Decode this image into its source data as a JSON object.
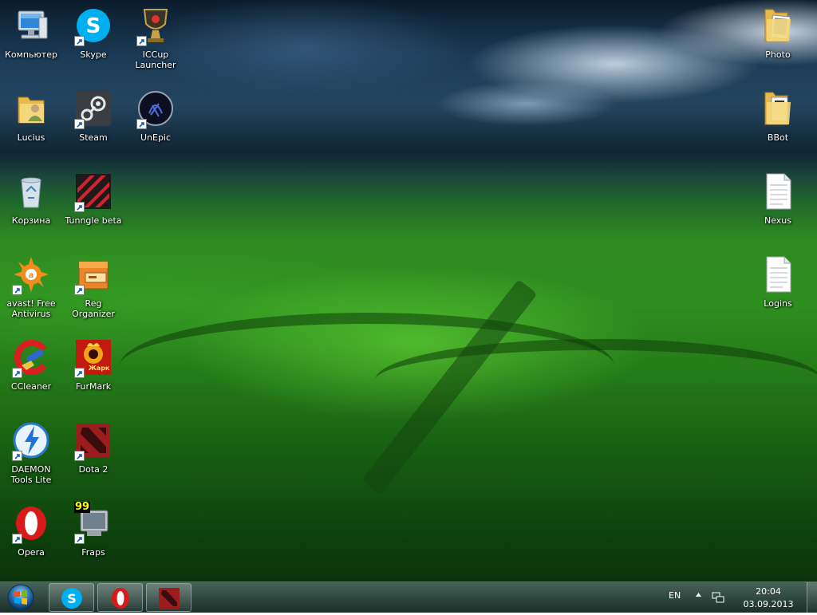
{
  "desktop": {
    "icons_left": {
      "computer": "Компьютер",
      "skype": "Skype",
      "iccup": "ICCup\nLauncher",
      "lucius": "Lucius",
      "steam": "Steam",
      "unepic": "UnEpic",
      "recycle_bin": "Корзина",
      "tunngle": "Tunngle beta",
      "avast": "avast! Free\nAntivirus",
      "reg_organizer": "Reg Organizer",
      "ccleaner": "CCleaner",
      "furmark": "FurMark",
      "daemon_tools": "DAEMON\nTools Lite",
      "dota2": "Dota 2",
      "opera": "Opera",
      "fraps": "Fraps"
    },
    "icons_right": {
      "photo": "Photo",
      "bbot": "BBot",
      "nexus": "Nexus",
      "logins": "Logins"
    },
    "icon_glyphs": {
      "fraps_counter": "99",
      "furmark_text": "Жарк"
    }
  },
  "taskbar": {
    "pinned": [
      "skype-icon",
      "opera-icon",
      "dota2-icon"
    ],
    "language": "EN",
    "time": "20:04",
    "date": "03.09.2013"
  },
  "colors": {
    "skype_blue": "#00aff0",
    "opera_red": "#d81a1a",
    "dota_red": "#9b1d1d",
    "folder_yellow": "#f0cf63"
  }
}
